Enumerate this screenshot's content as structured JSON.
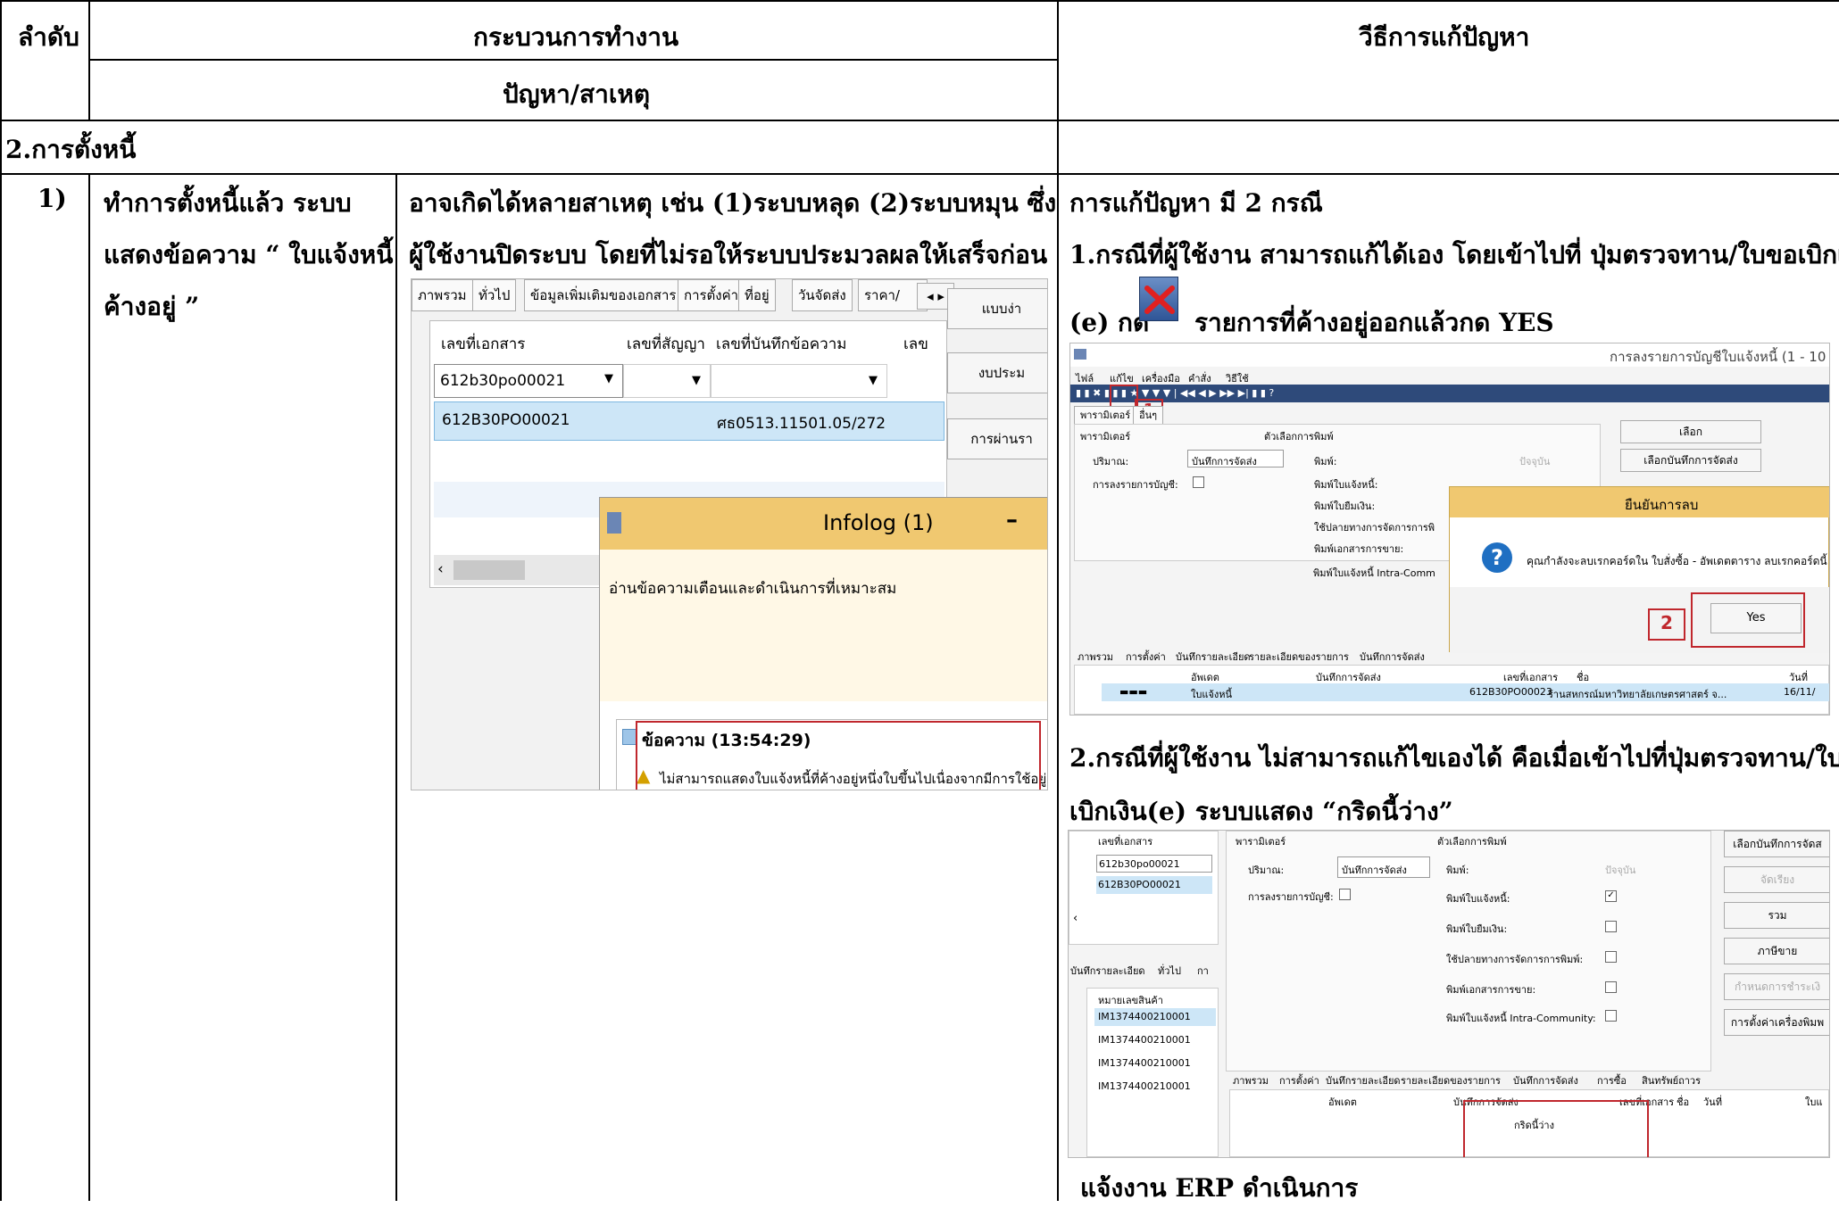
{
  "table": {
    "col_order_header": "ลำดับ",
    "col_process_header": "กระบวนการทำงาน",
    "col_problem_header": "ปัญหา/สาเหตุ",
    "col_solution_header": "วีธีการแก้ปัญหา",
    "section_title": "2.การตั้งหนี้",
    "row_number": "1)",
    "process_text": [
      "ทำการตั้งหนี้แล้ว ระบบ",
      "แสดงข้อความ “ ใบแจ้งหนี้",
      "ค้างอยู่ ”"
    ],
    "cause_text": [
      "อาจเกิดได้หลายสาเหตุ เช่น (1)ระบบหลุด  (2)ระบบหมุน ซึ่ง",
      "ผู้ใช้งานปิดระบบ โดยที่ไม่รอให้ระบบประมวลผลให้เสร็จก่อน"
    ],
    "solution_line1": "การแก้ปัญหา มี 2 กรณี",
    "solution_line2": "1.กรณีที่ผู้ใช้งาน สามารถแก้ได้เอง โดยเข้าไปที่ ปุ่มตรวจทาน/ใบขอเบิกเงิน",
    "solution_line3a": "(e) กด",
    "solution_line3b": "รายการที่ค้างอยู่ออกแล้วกด YES",
    "solution_line4": "2.กรณีที่ผู้ใช้งาน ไม่สามารถแก้ไขเองได้ คือเมื่อเข้าไปที่ปุ่มตรวจทาน/ใบขอ",
    "solution_line5": "เบิกเงิน(e) ระบบแสดง “กริดนี้ว่าง”",
    "solution_line6": "แจ้งงาน ERP ดำเนินการ"
  },
  "screenshot1": {
    "tabs": [
      "ภาพรวม",
      "ทั่วไป",
      "ข้อมูลเพิ่มเติมของเอกสาร",
      "การตั้งค่า",
      "ที่อยู่",
      "วันจัดส่ง",
      "ราคา/"
    ],
    "columns": [
      "เลขที่เอกสาร",
      "เลขที่สัญญา",
      "เลขที่บันทึกข้อความ",
      "เลข"
    ],
    "filter_value": "612b30po00021",
    "row": [
      "612B30PO00021",
      "",
      "ศธ0513.11501.05/272"
    ],
    "side_buttons": [
      "แบบง่า",
      "งบประม",
      "การผ่านรา"
    ],
    "infolog_title": "Infolog (1)",
    "infolog_message": "อ่านข้อความเตือนและดำเนินการที่เหมาะสม",
    "tree_header": "ข้อความ (13:54:29)",
    "tree_item": "ไม่สามารถแสดงใบแจ้งหนี้ที่ค้างอยู่หนึ่งใบขึ้นไปเนื่องจากมีการใช้อยู่"
  },
  "screenshot2": {
    "window_title": "การลงรายการบัญชีใบแจ้งหนี้ (1 - 10",
    "menu": [
      "ไฟล์",
      "แก้ไข",
      "เครื่องมือ",
      "คำสั่ง",
      "วิธีใช้"
    ],
    "tabs": [
      "พารามิเตอร์",
      "อื่นๆ"
    ],
    "param_label": "พารามิเตอร์",
    "print_label": "ตัวเลือกการพิมพ์",
    "qty_label": "ปริมาณ:",
    "qty_value": "บันทึกการจัดส่ง",
    "post_label": "การลงรายการบัญชี:",
    "print_opts": [
      "พิมพ์:",
      "พิมพ์ใบแจ้งหนี้:",
      "พิมพ์ใบยืมเงิน:",
      "ใช้ปลายทางการจัดการการพิ",
      "พิมพ์เอกสารการขาย:",
      "พิมพ์ใบแจ้งหนี้ Intra-Comm"
    ],
    "print_value": "ปัจจุบัน",
    "buttons": [
      "เลือก",
      "เลือกบันทึกการจัดส่ง"
    ],
    "dialog_title": "ยืนยันการลบ",
    "dialog_message": "คุณกำลังจะลบเรกคอร์ดใน ใบสั่งซื้อ - อัพเดตตาราง ลบเรกคอร์ดนี้",
    "yes_label": "Yes",
    "marker1": "1",
    "marker2": "2",
    "bottom_tabs": [
      "ภาพรวม",
      "การตั้งค่า",
      "บันทึกรายละเอียด",
      "รายละเอียดของรายการ",
      "บันทึกการจัดส่ง"
    ],
    "grid_cols": [
      "อัพเดต",
      "บันทึกการจัดส่ง",
      "เลขที่เอกสาร",
      "ชื่อ",
      "วันที่"
    ],
    "grid_row": [
      "ใบแจ้งหนี้",
      "612B30PO00023",
      "ร้านสหกรณ์มหาวิทยาลัยเกษตรศาสตร์ จ...",
      "16/11/"
    ]
  },
  "screenshot3": {
    "doc_col": "เลขที่เอกสาร",
    "docs": [
      "612b30po00021",
      "612B30PO00021"
    ],
    "left_tabs": [
      "บันทึกรายละเอียด",
      "ทั่วไป",
      "กา"
    ],
    "item_col": "หมายเลขสินค้า",
    "items": [
      "IM1374400210001",
      "IM1374400210001",
      "IM1374400210001",
      "IM1374400210001"
    ],
    "param_label": "พารามิเตอร์",
    "print_label": "ตัวเลือกการพิมพ์",
    "qty_label": "ปริมาณ:",
    "qty_value": "บันทึกการจัดส่ง",
    "post_label": "การลงรายการบัญชี:",
    "print_opts": [
      "พิมพ์:",
      "พิมพ์ใบแจ้งหนี้:",
      "พิมพ์ใบยืมเงิน:",
      "ใช้ปลายทางการจัดการการพิมพ์:",
      "พิมพ์เอกสารการขาย:",
      "พิมพ์ใบแจ้งหนี้ Intra-Community:"
    ],
    "print_value": "ปัจจุบัน",
    "buttons": [
      "เลือกบันทึกการจัดส",
      "จัดเรียง",
      "รวม",
      "ภาษีขาย",
      "กำหนดการชำระเงิ",
      "การตั้งค่าเครื่องพิมพ"
    ],
    "bottom_tabs": [
      "ภาพรวม",
      "การตั้งค่า",
      "บันทึกรายละเอียด",
      "รายละเอียดของรายการ",
      "บันทึกการจัดส่ง",
      "การซื้อ",
      "สินทรัพย์ถาวร"
    ],
    "grid_cols": [
      "อัพเดต",
      "บันทึกการจัดส่ง",
      "เลขที่เอกสาร",
      "ชื่อ",
      "วันที่",
      "ใบแ"
    ],
    "empty_text": "กริดนี้ว่าง"
  }
}
